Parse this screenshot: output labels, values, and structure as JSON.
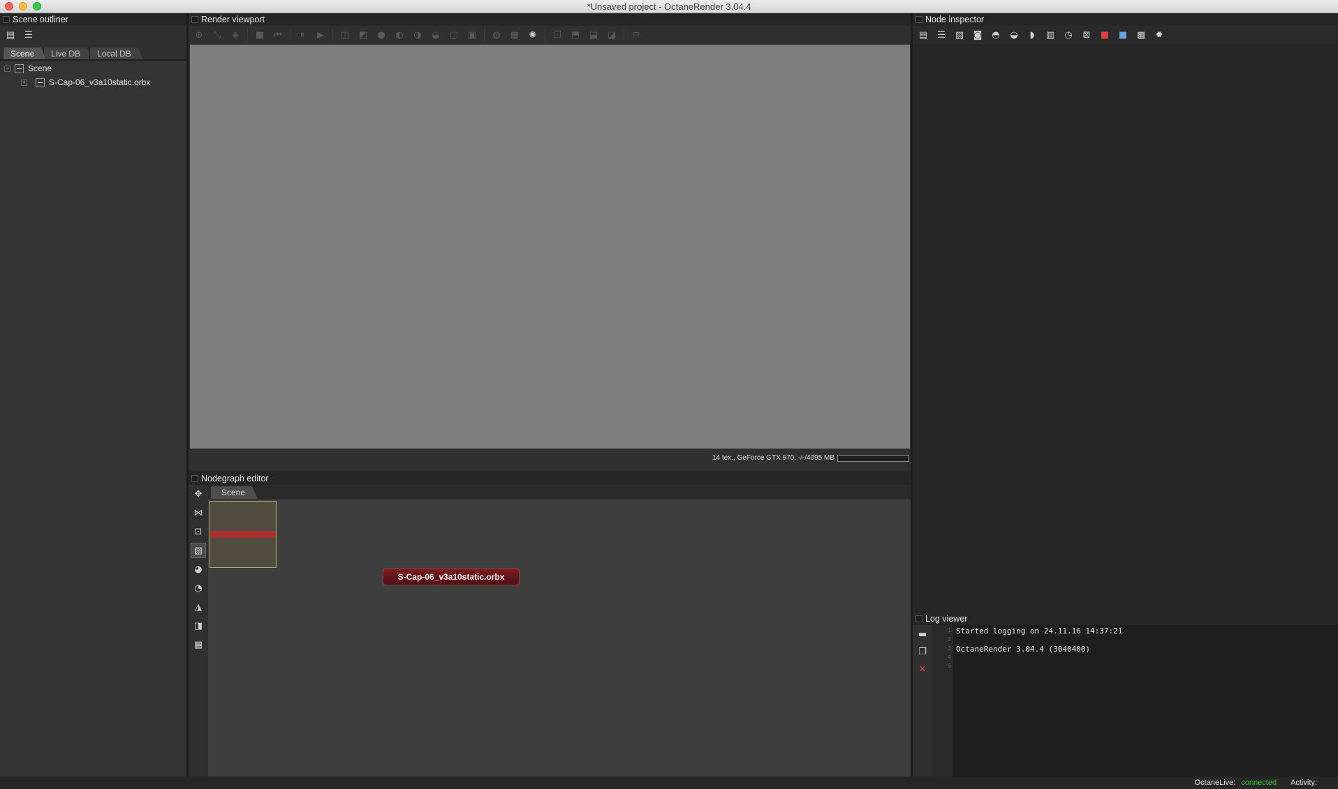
{
  "window": {
    "title": "*Unsaved project - OctaneRender 3.04.4"
  },
  "outliner": {
    "title": "Scene outliner",
    "tabs": [
      {
        "label": "Scene",
        "active": true
      },
      {
        "label": "Live DB",
        "active": false
      },
      {
        "label": "Local DB",
        "active": false
      }
    ],
    "tree": [
      {
        "label": "Scene",
        "expander": "−"
      },
      {
        "label": "S-Cap-06_v3a10static.orbx",
        "expander": "+"
      }
    ]
  },
  "viewport": {
    "title": "Render viewport",
    "status_text": "14 tex., GeForce GTX 970, -/-/4095 MB"
  },
  "nodegraph": {
    "title": "Nodegraph editor",
    "tab_label": "Scene",
    "node_label": "S-Cap-06_v3a10static.orbx"
  },
  "inspector": {
    "title": "Node inspector"
  },
  "log": {
    "title": "Log viewer",
    "line_numbers": [
      "1",
      "2",
      "3",
      "4",
      "5"
    ],
    "lines": [
      "Started logging on 24.11.16 14:37:21",
      "",
      "OctaneRender 3.04.4 (3040400)",
      "",
      ""
    ]
  },
  "statusbar": {
    "live_label": "OctaneLive:",
    "live_status": "connected",
    "activity_label": "Activity:"
  },
  "colors": {
    "viewport_bg": "#7f7f7f",
    "node_fill": "#6a161a",
    "connected": "#3ec83e"
  }
}
